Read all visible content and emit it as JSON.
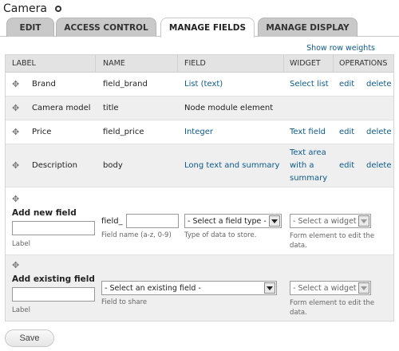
{
  "page": {
    "title": "Camera",
    "settings_icon": "gear-icon"
  },
  "tabs": [
    {
      "label": "EDIT",
      "active": false
    },
    {
      "label": "ACCESS CONTROL",
      "active": false
    },
    {
      "label": "MANAGE FIELDS",
      "active": true
    },
    {
      "label": "MANAGE DISPLAY",
      "active": false
    }
  ],
  "row_weights_link": "Show row weights",
  "table": {
    "headers": [
      "LABEL",
      "NAME",
      "FIELD",
      "WIDGET",
      "OPERATIONS"
    ],
    "rows": [
      {
        "label": "Brand",
        "name": "field_brand",
        "field": "List (text)",
        "widget": "Select list",
        "edit": "edit",
        "delete": "delete"
      },
      {
        "label": "Camera model",
        "name": "title",
        "field": "Node module element",
        "widget": "",
        "edit": "",
        "delete": ""
      },
      {
        "label": "Price",
        "name": "field_price",
        "field": "Integer",
        "widget": "Text field",
        "edit": "edit",
        "delete": "delete"
      },
      {
        "label": "Description",
        "name": "body",
        "field": "Long text and summary",
        "widget_lines": [
          "Text area",
          "with a",
          "summary"
        ],
        "edit": "edit",
        "delete": "delete"
      }
    ]
  },
  "add_new_field": {
    "heading": "Add new field",
    "label_hint": "Label",
    "name_prefix": "field_",
    "name_hint": "Field name (a-z, 0-9)",
    "type_select": "- Select a field type -",
    "type_hint": "Type of data to store.",
    "widget_select": "- Select a widget -",
    "widget_hint_lines": [
      "Form element to edit the",
      "data."
    ]
  },
  "add_existing_field": {
    "heading": "Add existing field",
    "label_hint": "Label",
    "field_select": "- Select an existing field -",
    "field_hint": "Field to share",
    "widget_select": "- Select a widget -",
    "widget_hint_lines": [
      "Form element to edit the",
      "data."
    ]
  },
  "save_label": "Save",
  "colors": {
    "link": "#0c5a8c",
    "tab_bg": "#c9c9c9",
    "header_bg": "#e3e3e3",
    "row_alt": "#efefef"
  }
}
